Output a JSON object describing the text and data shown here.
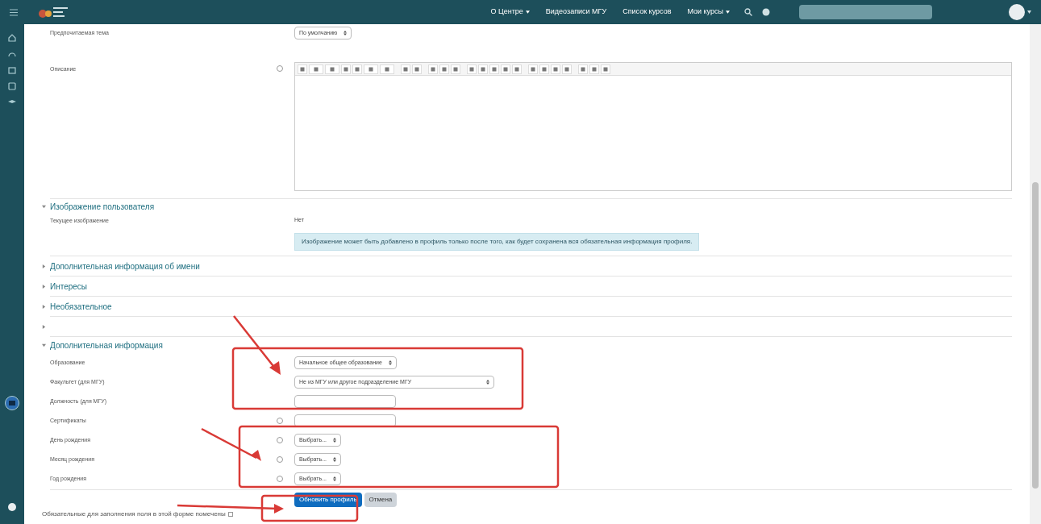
{
  "header": {
    "nav": [
      {
        "label": "О Центре",
        "dropdown": true
      },
      {
        "label": "Видеозаписи МГУ",
        "dropdown": false
      },
      {
        "label": "Список курсов",
        "dropdown": false
      },
      {
        "label": "Мои курсы",
        "dropdown": true
      }
    ]
  },
  "form": {
    "rows": [
      {
        "kind": "select",
        "label": "Предпочитаемая тема",
        "value": "По умолчанию",
        "help": false
      },
      {
        "kind": "editor",
        "label": "Описание",
        "help": true
      }
    ],
    "sections": [
      {
        "title": "Изображение пользователя",
        "expanded": true,
        "fields": [
          {
            "kind": "static",
            "label": "Текущее изображение",
            "value": "Нет",
            "help": false
          },
          {
            "kind": "alert",
            "text": "Изображение может быть добавлено в профиль только после того, как будет сохранена вся обязательная информация профиля."
          }
        ]
      },
      {
        "title": "Дополнительная информация об имени",
        "expanded": false
      },
      {
        "title": "Интересы",
        "expanded": false
      },
      {
        "title": "Необязательное",
        "expanded": false
      },
      {
        "expanded": false
      },
      {
        "title": "Дополнительная информация",
        "expanded": true,
        "fields": [
          {
            "kind": "select",
            "label": "Образование",
            "value": "Начальное общее образование",
            "help": false
          },
          {
            "kind": "select",
            "label": "Факультет (для МГУ)",
            "value": "Не из МГУ или другое подразделение МГУ",
            "help": false,
            "wide": true
          },
          {
            "kind": "text",
            "label": "Должность (для МГУ)",
            "help": false
          },
          {
            "kind": "text",
            "label": "Сертификаты",
            "help": true
          },
          {
            "kind": "select",
            "label": "День рождения",
            "value": "Выбрать...",
            "help": true
          },
          {
            "kind": "select",
            "label": "Месяц рождения",
            "value": "Выбрать...",
            "help": true
          },
          {
            "kind": "select",
            "label": "Год рождения",
            "value": "Выбрать...",
            "help": true
          }
        ]
      }
    ],
    "buttons": [
      {
        "label": "Обновить профиль",
        "primary": true
      },
      {
        "label": "Отмена",
        "primary": false
      }
    ],
    "footer": "Обязательные для заполнения поля в этой форме помечены"
  }
}
